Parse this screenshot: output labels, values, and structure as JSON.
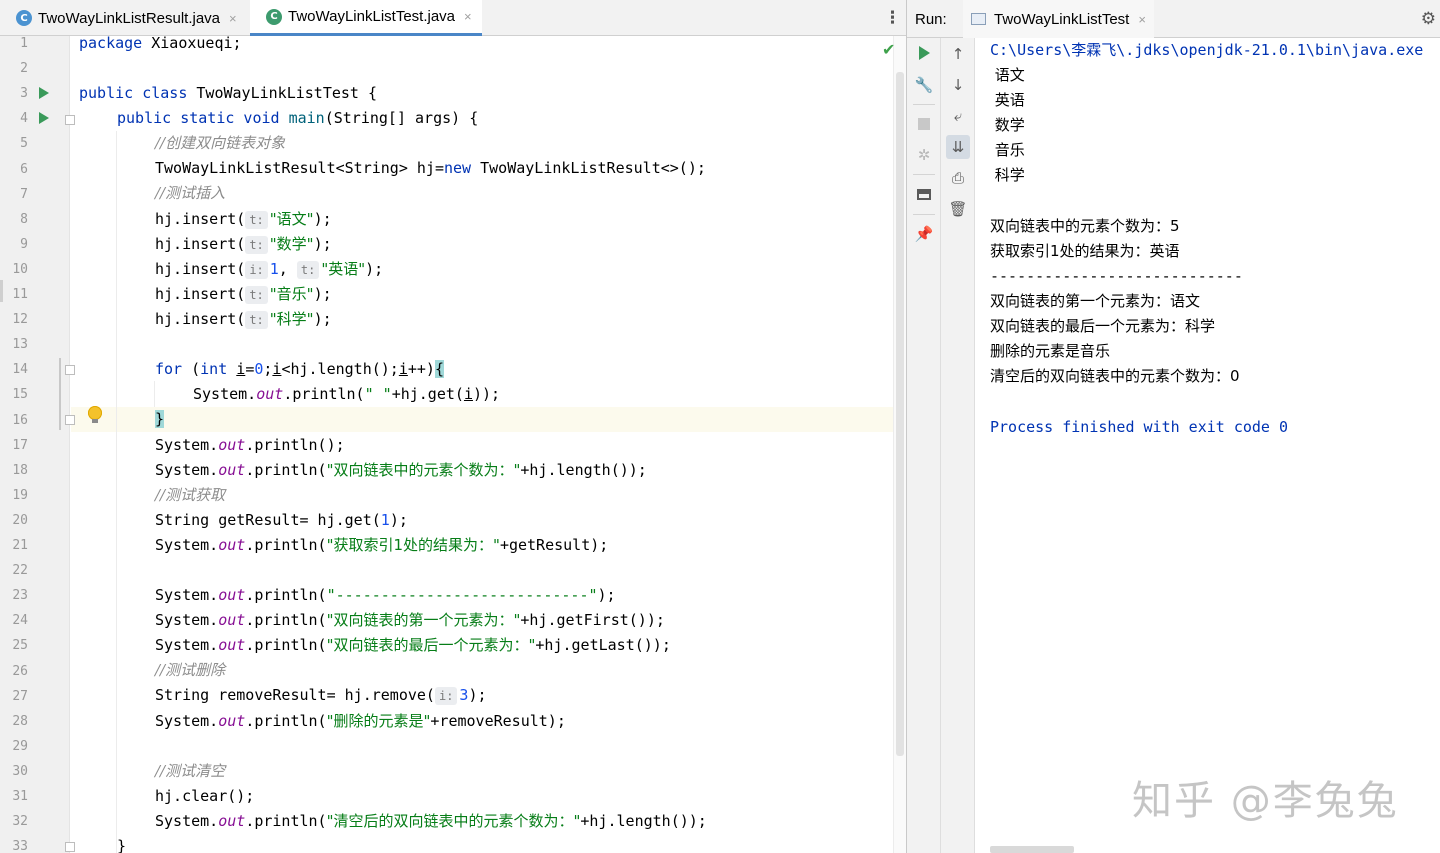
{
  "editor": {
    "tabs": [
      {
        "label": "TwoWayLinkListResult.java",
        "icon": "java-class-icon",
        "close": "×"
      },
      {
        "label": "TwoWayLinkListTest.java",
        "icon": "java-test-class-icon",
        "close": "×",
        "active": true
      }
    ],
    "line_numbers": [
      "1",
      "2",
      "3",
      "4",
      "5",
      "6",
      "7",
      "8",
      "9",
      "10",
      "11",
      "12",
      "13",
      "14",
      "15",
      "16",
      "17",
      "18",
      "19",
      "20",
      "21",
      "22",
      "23",
      "24",
      "25",
      "26",
      "27",
      "28",
      "29",
      "30",
      "31",
      "32",
      "33"
    ],
    "code": {
      "l1_kw": "package",
      "l1_rest": " Xiaoxueqi;",
      "l3_kw": "public class",
      "l3_rest": " TwoWayLinkListTest {",
      "l4_kw1": "public static void",
      "l4_name": " main",
      "l4_rest": "(String[] args) {",
      "l5_com": "//创建双向链表对象",
      "l6_a": "TwoWayLinkListResult<String> hj=",
      "l6_kw": "new",
      "l6_b": " TwoWayLinkListResult<>();",
      "l7_com": "//测试插入",
      "l8_a": "hj.insert(",
      "l8_hint": "t:",
      "l8_str": "\"语文\"",
      "l8_b": ");",
      "l9_a": "hj.insert(",
      "l9_hint": "t:",
      "l9_str": "\"数学\"",
      "l9_b": ");",
      "l10_a": "hj.insert(",
      "l10_hint1": "i:",
      "l10_num": "1",
      "l10_comma": ", ",
      "l10_hint2": "t:",
      "l10_str": "\"英语\"",
      "l10_b": ");",
      "l11_a": "hj.insert(",
      "l11_hint": "t:",
      "l11_str": "\"音乐\"",
      "l11_b": ");",
      "l12_a": "hj.insert(",
      "l12_hint": "t:",
      "l12_str": "\"科学\"",
      "l12_b": ");",
      "l14_kw": "for",
      "l14_a": " (",
      "l14_kw2": "int",
      "l14_sp": " ",
      "l14_i1": "i",
      "l14_eq": "=",
      "l14_num": "0",
      "l14_b": ";",
      "l14_i2": "i",
      "l14_c": "<hj.length();",
      "l14_i3": "i",
      "l14_d": "++)",
      "l14_brace": "{",
      "l15_a": "System.",
      "l15_fld": "out",
      "l15_b": ".println(",
      "l15_str": "\" \"",
      "l15_c": "+hj.get(",
      "l15_i": "i",
      "l15_d": "));",
      "l16_brace": "}",
      "l17_a": "System.",
      "l17_fld": "out",
      "l17_b": ".println();",
      "l18_a": "System.",
      "l18_fld": "out",
      "l18_b": ".println(",
      "l18_str": "\"双向链表中的元素个数为：\"",
      "l18_c": "+hj.length());",
      "l19_com": "//测试获取",
      "l20_a": "String getResult= hj.get(",
      "l20_num": "1",
      "l20_b": ");",
      "l21_a": "System.",
      "l21_fld": "out",
      "l21_b": ".println(",
      "l21_str": "\"获取索引1处的结果为：\"",
      "l21_c": "+getResult);",
      "l23_a": "System.",
      "l23_fld": "out",
      "l23_b": ".println(",
      "l23_str": "\"----------------------------\"",
      "l23_c": ");",
      "l24_a": "System.",
      "l24_fld": "out",
      "l24_b": ".println(",
      "l24_str": "\"双向链表的第一个元素为：\"",
      "l24_c": "+hj.getFirst());",
      "l25_a": "System.",
      "l25_fld": "out",
      "l25_b": ".println(",
      "l25_str": "\"双向链表的最后一个元素为：\"",
      "l25_c": "+hj.getLast());",
      "l26_com": "//测试删除",
      "l27_a": "String removeResult= hj.remove(",
      "l27_hint": "i:",
      "l27_num": "3",
      "l27_b": ");",
      "l28_a": "System.",
      "l28_fld": "out",
      "l28_b": ".println(",
      "l28_str": "\"删除的元素是\"",
      "l28_c": "+removeResult);",
      "l30_com": "//测试清空",
      "l31_a": "hj.clear();",
      "l32_a": "System.",
      "l32_fld": "out",
      "l32_b": ".println(",
      "l32_str": "\"清空后的双向链表中的元素个数为：\"",
      "l32_c": "+hj.length());",
      "l33_a": "}"
    }
  },
  "run": {
    "label": "Run:",
    "tab_label": "TwoWayLinkListTest",
    "tab_close": "×",
    "toolbar_icons": [
      "rerun-icon",
      "wrench-icon",
      "stop-icon",
      "debug-icon",
      "layout-icon",
      "pin-icon",
      "scroll-up-icon",
      "scroll-down-icon",
      "soft-wrap-icon",
      "scroll-to-end-icon",
      "print-icon",
      "trash-icon"
    ],
    "output": {
      "path": "C:\\Users\\李霖飞\\.jdks\\openjdk-21.0.1\\bin\\java.exe",
      "items": [
        " 语文",
        " 英语",
        " 数学",
        " 音乐",
        " 科学"
      ],
      "count": "双向链表中的元素个数为：5",
      "get_result": "获取索引1处的结果为：英语",
      "separator": "----------------------------",
      "first": "双向链表的第一个元素为：语文",
      "last": "双向链表的最后一个元素为：科学",
      "removed": "删除的元素是音乐",
      "after_clear": "清空后的双向链表中的元素个数为：0",
      "finished": "Process finished with exit code 0"
    }
  },
  "watermark": "知乎 @李兔兔",
  "colors": {
    "keyword": "#0033b3",
    "string": "#067d17",
    "number": "#1750eb",
    "comment": "#8c8c8c",
    "field": "#871094",
    "tab_underline": "#4a86c7"
  }
}
